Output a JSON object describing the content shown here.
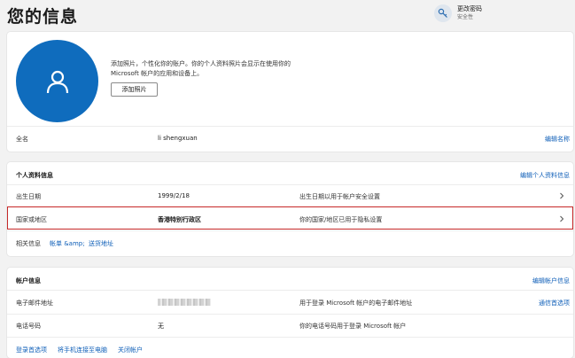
{
  "page": {
    "title": "您的信息"
  },
  "header_link": {
    "title": "更改密码",
    "subtitle": "安全性",
    "icon": "key-icon"
  },
  "profile": {
    "description": "添加照片，个性化你的账户。你的个人资料照片会显示在使用你的 Microsoft 帐户的应用和设备上。",
    "add_photo_label": "添加照片",
    "fullname_label": "全名",
    "fullname_value": "li shengxuan",
    "edit_name_link": "编辑名称",
    "avatar_icon": "person-icon",
    "accent_color": "#0f6cbd"
  },
  "personal": {
    "section_title": "个人资料信息",
    "edit_link": "编辑个人资料信息",
    "rows": [
      {
        "label": "出生日期",
        "value": "1999/2/18",
        "desc": "出生日期以用于帐户安全设置"
      },
      {
        "label": "国家或地区",
        "value": "香港特别行政区",
        "desc": "你的国家/地区已用于隐私设置"
      }
    ],
    "related_label": "相关信息",
    "related_link1": "帐单 &amp;",
    "related_link2": "送货地址",
    "highlight_color": "#c62828"
  },
  "account": {
    "section_title": "帐户信息",
    "edit_link": "编辑帐户信息",
    "rows": [
      {
        "label": "电子邮件地址",
        "value": "",
        "desc": "用于登录 Microsoft 帐户的电子邮件地址",
        "action": "通信首选项"
      },
      {
        "label": "电话号码",
        "value": "无",
        "desc": "你的电话号码用于登录 Microsoft 帐户",
        "action": ""
      }
    ],
    "footer_links": [
      "登录首选项",
      "将手机连接至电脑",
      "关闭帐户"
    ],
    "link_color": "#0f5fb8"
  }
}
